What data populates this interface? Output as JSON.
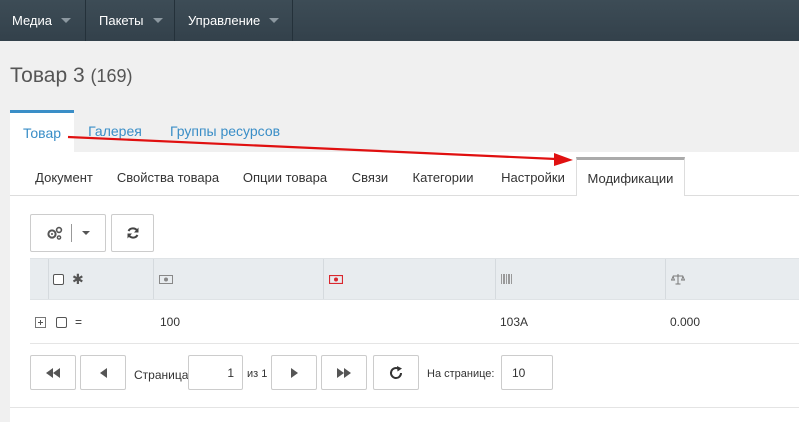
{
  "topnav": {
    "items": [
      {
        "label": "Медиа"
      },
      {
        "label": "Пакеты"
      },
      {
        "label": "Управление"
      }
    ]
  },
  "page": {
    "title": "Товар 3",
    "count": "(169)"
  },
  "outer_tabs": [
    {
      "label": "Товар",
      "active": true
    },
    {
      "label": "Галерея"
    },
    {
      "label": "Группы ресурсов"
    }
  ],
  "inner_tabs": [
    {
      "label": "Документ"
    },
    {
      "label": "Свойства товара"
    },
    {
      "label": "Опции товара"
    },
    {
      "label": "Связи"
    },
    {
      "label": "Категории"
    },
    {
      "label": "Настройки"
    },
    {
      "label": "Модификации",
      "active": true
    }
  ],
  "toolbar": {
    "actions_icon": "gears-icon",
    "refresh_icon": "refresh-icon"
  },
  "grid": {
    "columns": [
      {
        "icon": "checkbox"
      },
      {
        "icon": "asterisk-icon",
        "label": "✱"
      },
      {
        "icon": "money-icon",
        "color": "#888888"
      },
      {
        "icon": "money-icon",
        "color": "#d9272e"
      },
      {
        "icon": "barcode-icon"
      },
      {
        "icon": "scales-icon"
      }
    ],
    "rows": [
      {
        "mark": "=",
        "price": "100",
        "article": "103A",
        "weight": "0.000"
      }
    ]
  },
  "pager": {
    "page_label": "Страница",
    "page_value": "1",
    "of_label": "из 1",
    "per_page_label": "На странице:",
    "per_page_value": "10"
  },
  "colors": {
    "accent": "#3a8ec7",
    "arrow": "#e01010",
    "nav_bg": "#37454f"
  }
}
